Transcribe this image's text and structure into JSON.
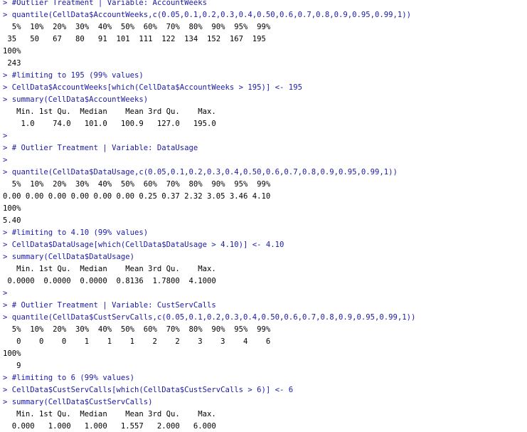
{
  "console": {
    "lines": [
      {
        "kind": "input",
        "text": "> #Outlier Treatment | Variable: AccountWeeks"
      },
      {
        "kind": "input",
        "text": "> quantile(CellData$AccountWeeks,c(0.05,0.1,0.2,0.3,0.4,0.50,0.6,0.7,0.8,0.9,0.95,0.99,1))"
      },
      {
        "kind": "output",
        "text": "  5%  10%  20%  30%  40%  50%  60%  70%  80%  90%  95%  99%"
      },
      {
        "kind": "output",
        "text": " 35   50   67   80   91  101  111  122  134  152  167  195"
      },
      {
        "kind": "output",
        "text": "100%"
      },
      {
        "kind": "output",
        "text": " 243"
      },
      {
        "kind": "input",
        "text": "> #limiting to 195 (99% values)"
      },
      {
        "kind": "input",
        "text": "> CellData$AccountWeeks[which(CellData$AccountWeeks > 195)] <- 195"
      },
      {
        "kind": "input",
        "text": "> summary(CellData$AccountWeeks)"
      },
      {
        "kind": "output",
        "text": "   Min. 1st Qu.  Median    Mean 3rd Qu.    Max."
      },
      {
        "kind": "output",
        "text": "    1.0    74.0   101.0   100.9   127.0   195.0"
      },
      {
        "kind": "input",
        "text": ">"
      },
      {
        "kind": "input",
        "text": "> # Outlier Treatment | Variable: DataUsage"
      },
      {
        "kind": "input",
        "text": ">"
      },
      {
        "kind": "input",
        "text": "> quantile(CellData$DataUsage,c(0.05,0.1,0.2,0.3,0.4,0.50,0.6,0.7,0.8,0.9,0.95,0.99,1))"
      },
      {
        "kind": "output",
        "text": "  5%  10%  20%  30%  40%  50%  60%  70%  80%  90%  95%  99%"
      },
      {
        "kind": "output",
        "text": "0.00 0.00 0.00 0.00 0.00 0.00 0.25 0.37 2.32 3.05 3.46 4.10"
      },
      {
        "kind": "output",
        "text": "100%"
      },
      {
        "kind": "output",
        "text": "5.40"
      },
      {
        "kind": "input",
        "text": "> #limiting to 4.10 (99% values)"
      },
      {
        "kind": "input",
        "text": "> CellData$DataUsage[which(CellData$DataUsage > 4.10)] <- 4.10"
      },
      {
        "kind": "input",
        "text": "> summary(CellData$DataUsage)"
      },
      {
        "kind": "output",
        "text": "   Min. 1st Qu.  Median    Mean 3rd Qu.    Max."
      },
      {
        "kind": "output",
        "text": " 0.0000  0.0000  0.0000  0.8136  1.7800  4.1000"
      },
      {
        "kind": "input",
        "text": ">"
      },
      {
        "kind": "input",
        "text": "> # Outlier Treatment | Variable: CustServCalls"
      },
      {
        "kind": "input",
        "text": "> quantile(CellData$CustServCalls,c(0.05,0.1,0.2,0.3,0.4,0.50,0.6,0.7,0.8,0.9,0.95,0.99,1))"
      },
      {
        "kind": "output",
        "text": "  5%  10%  20%  30%  40%  50%  60%  70%  80%  90%  95%  99%"
      },
      {
        "kind": "output",
        "text": "   0    0    0    1    1    1    2    2    3    3    4    6"
      },
      {
        "kind": "output",
        "text": "100%"
      },
      {
        "kind": "output",
        "text": "   9"
      },
      {
        "kind": "input",
        "text": "> #limiting to 6 (99% values)"
      },
      {
        "kind": "input",
        "text": "> CellData$CustServCalls[which(CellData$CustServCalls > 6)] <- 6"
      },
      {
        "kind": "input",
        "text": "> summary(CellData$CustServCalls)"
      },
      {
        "kind": "output",
        "text": "   Min. 1st Qu.  Median    Mean 3rd Qu.    Max."
      },
      {
        "kind": "output",
        "text": "  0.000   1.000   1.000   1.557   2.000   6.000"
      }
    ],
    "colors": {
      "input": "#1a1aa6",
      "output": "#000000",
      "background": "#ffffff"
    }
  }
}
